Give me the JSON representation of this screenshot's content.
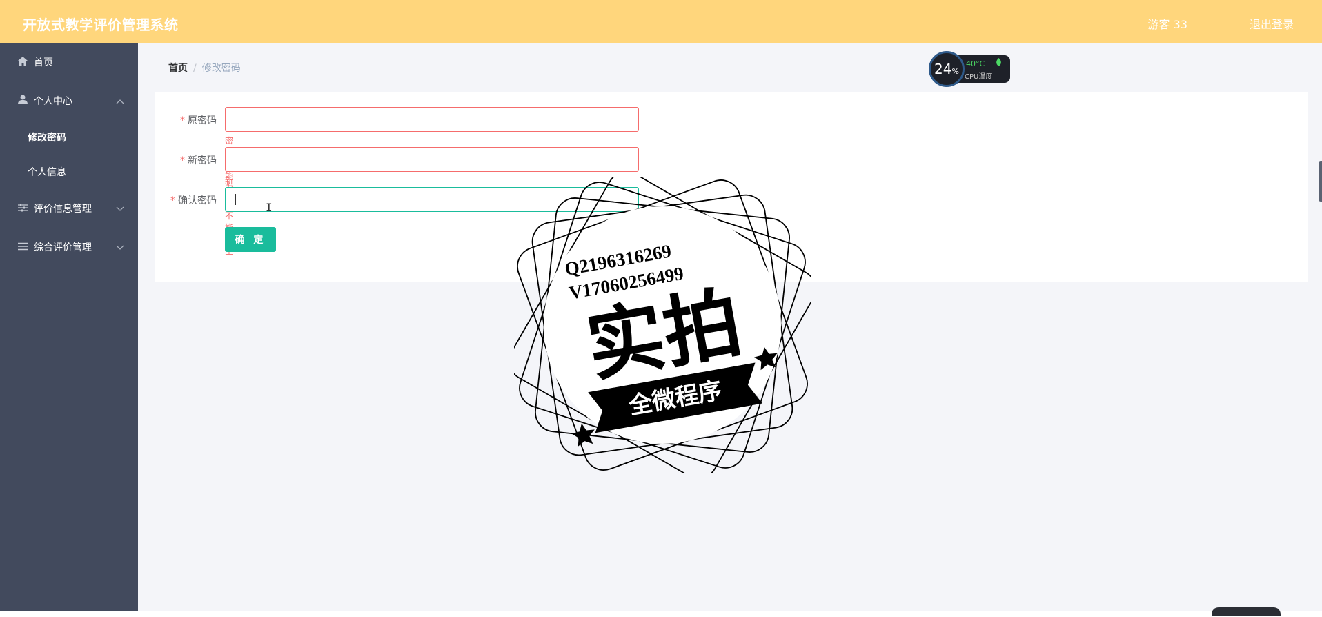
{
  "header": {
    "app_title": "开放式教学评价管理系统",
    "user_label": "游客 33",
    "logout_label": "退出登录"
  },
  "sidebar": {
    "items": [
      {
        "label": "首页",
        "icon": "home-icon"
      },
      {
        "label": "个人中心",
        "icon": "user-icon",
        "expanded": true,
        "children": [
          {
            "label": "修改密码",
            "active": true
          },
          {
            "label": "个人信息",
            "active": false
          }
        ]
      },
      {
        "label": "评价信息管理",
        "icon": "sliders-icon",
        "expanded": false
      },
      {
        "label": "综合评价管理",
        "icon": "list-icon",
        "expanded": false
      }
    ]
  },
  "breadcrumb": {
    "home": "首页",
    "separator": "/",
    "current": "修改密码"
  },
  "form": {
    "required_mark": "*",
    "old_password": {
      "label": "原密码",
      "value": "",
      "error": "密码不能为空"
    },
    "new_password": {
      "label": "新密码",
      "value": "",
      "error": "新密码不能为空"
    },
    "confirm_password": {
      "label": "确认密码",
      "value": ""
    },
    "submit_label": "确 定"
  },
  "cpu_widget": {
    "percent": "24",
    "percent_unit": "%",
    "temperature": "40°C",
    "label": "CPU温度"
  },
  "watermark": {
    "line1": "Q2196316269",
    "line2": "V17060256499",
    "main": "实拍",
    "ribbon": "全微程序"
  },
  "colors": {
    "topbar": "#ffd67c",
    "sidebar": "#424a5d",
    "accent": "#1abc9c",
    "error": "#f56c6c"
  }
}
